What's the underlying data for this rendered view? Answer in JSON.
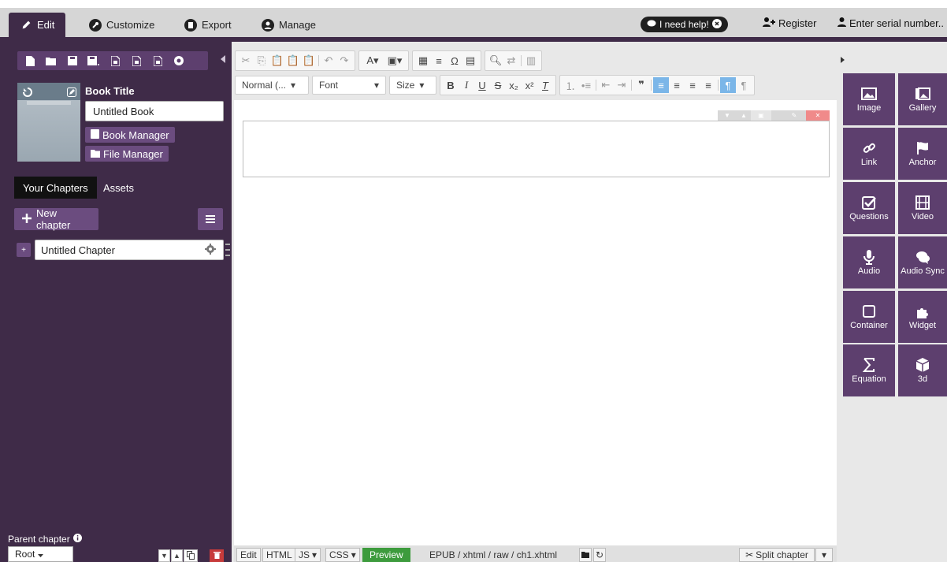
{
  "nav": {
    "tabs": [
      {
        "label": "Edit",
        "icon": "pencil-icon"
      },
      {
        "label": "Customize",
        "icon": "wrench-icon"
      },
      {
        "label": "Export",
        "icon": "export-icon"
      },
      {
        "label": "Manage",
        "icon": "user-icon"
      }
    ],
    "help_label": "I need help!",
    "register_label": "Register",
    "serial_label": "Enter serial number.."
  },
  "sidebar": {
    "book_title_label": "Book Title",
    "book_title_value": "Untitled Book",
    "book_manager_label": "Book Manager",
    "file_manager_label": "File Manager",
    "tabs": [
      "Your Chapters",
      "Assets"
    ],
    "new_chapter_label": "New chapter",
    "chapters": [
      {
        "title": "Untitled Chapter"
      }
    ],
    "parent_chapter_label": "Parent chapter",
    "parent_chapter_value": "Root"
  },
  "toolbar": {
    "format_label": "Normal (...",
    "font_label": "Font",
    "size_label": "Size"
  },
  "bottom": {
    "edit_label": "Edit",
    "html_label": "HTML",
    "js_label": "JS",
    "css_label": "CSS",
    "preview_label": "Preview",
    "path": "EPUB / xhtml / raw / ch1.xhtml",
    "split_label": "Split chapter"
  },
  "widgets": [
    {
      "label": "Image",
      "icon": "image-icon"
    },
    {
      "label": "Gallery",
      "icon": "gallery-icon"
    },
    {
      "label": "Link",
      "icon": "link-icon"
    },
    {
      "label": "Anchor",
      "icon": "flag-icon"
    },
    {
      "label": "Questions",
      "icon": "checkbox-icon"
    },
    {
      "label": "Video",
      "icon": "film-icon"
    },
    {
      "label": "Audio",
      "icon": "microphone-icon"
    },
    {
      "label": "Audio Sync",
      "icon": "chat-icon"
    },
    {
      "label": "Container",
      "icon": "square-icon"
    },
    {
      "label": "Widget",
      "icon": "puzzle-icon"
    },
    {
      "label": "Equation",
      "icon": "sigma-icon"
    },
    {
      "label": "3d",
      "icon": "cube-icon"
    }
  ],
  "colors": {
    "sidebar_bg": "#3f2b48",
    "accent_purple": "#6b4c7f",
    "widget_purple": "#5d3f6e",
    "preview_green": "#3d9b3d"
  }
}
